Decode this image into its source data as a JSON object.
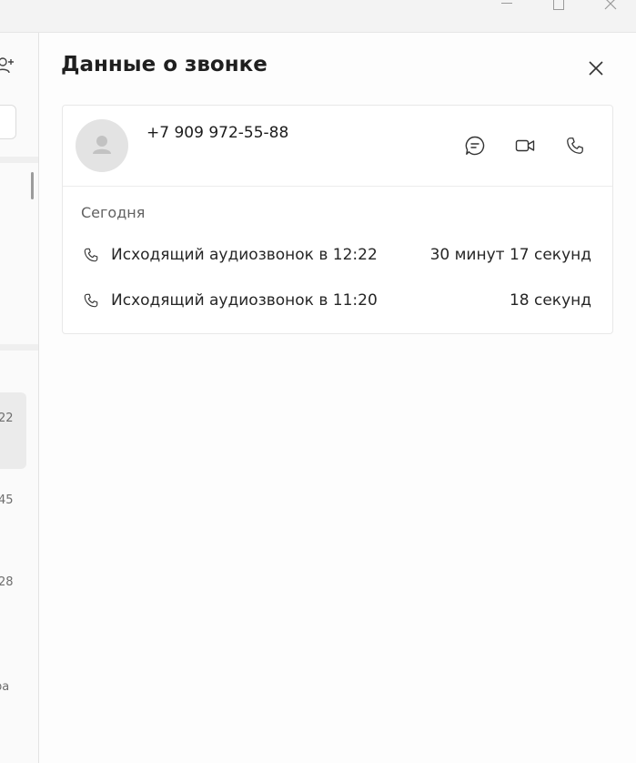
{
  "window": {
    "minimize_icon": "minimize-icon",
    "maximize_icon": "maximize-icon",
    "close_icon": "close-icon"
  },
  "sidebar": {
    "item_times": [
      "22",
      "45",
      "28"
    ],
    "item_trailing_text": "pa"
  },
  "panel": {
    "title": "Данные о звонке",
    "close_icon": "close-icon"
  },
  "contact": {
    "number": "+7 909 972-55-88",
    "actions": [
      {
        "name": "chat",
        "icon": "chat-bubble-icon"
      },
      {
        "name": "video",
        "icon": "video-camera-icon"
      },
      {
        "name": "call",
        "icon": "phone-icon"
      }
    ]
  },
  "history": {
    "section_label": "Сегодня",
    "calls": [
      {
        "description": "Исходящий аудиозвонок в 12:22",
        "duration": "30 минут 17 секунд",
        "icon": "phone-icon"
      },
      {
        "description": "Исходящий аудиозвонок в 11:20",
        "duration": "18 секунд",
        "icon": "phone-icon"
      }
    ]
  },
  "colors": {
    "title_bar": "#f3f3f3",
    "background": "#fdfdfd",
    "avatar_bg": "#e3e3e3",
    "text_primary": "#1f1f1f",
    "text_secondary": "#616161"
  }
}
